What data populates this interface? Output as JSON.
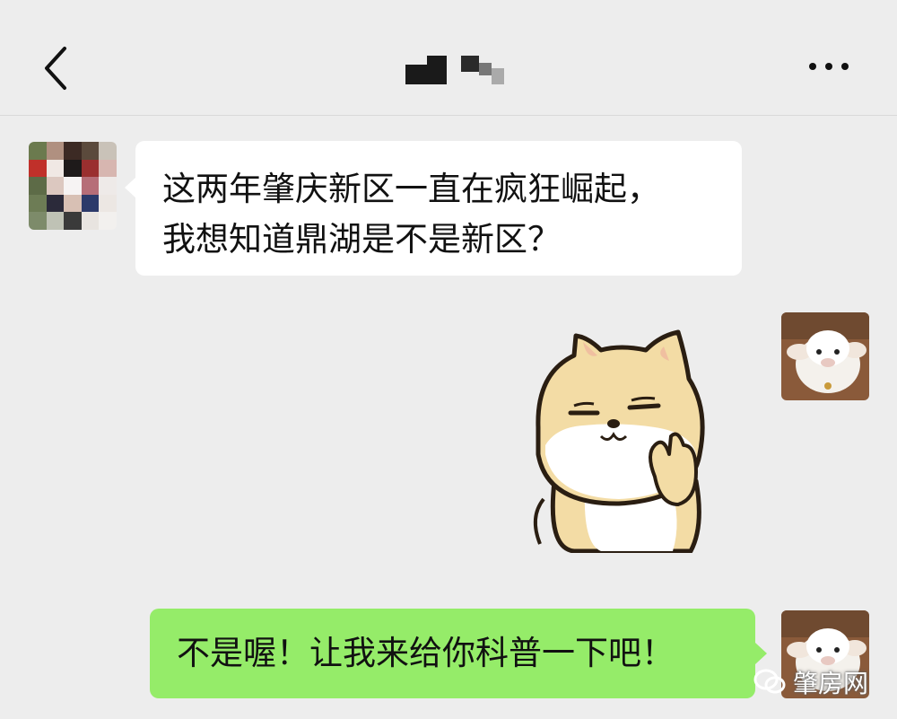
{
  "header": {
    "back_icon": "chevron-left-icon",
    "more_icon": "more-dots-icon"
  },
  "messages": [
    {
      "sender": "other",
      "text": "这两年肇庆新区一直在疯狂崛起，\n我想知道鼎湖是不是新区？"
    },
    {
      "sender": "me",
      "type": "sticker",
      "sticker": "shiba-dog-thinking-sticker"
    },
    {
      "sender": "me",
      "text": "不是喔！让我来给你科普一下吧！"
    }
  ],
  "watermark": {
    "text": "肇房网"
  },
  "colors": {
    "background": "#ededed",
    "incoming_bubble": "#ffffff",
    "outgoing_bubble": "#95ec69"
  }
}
